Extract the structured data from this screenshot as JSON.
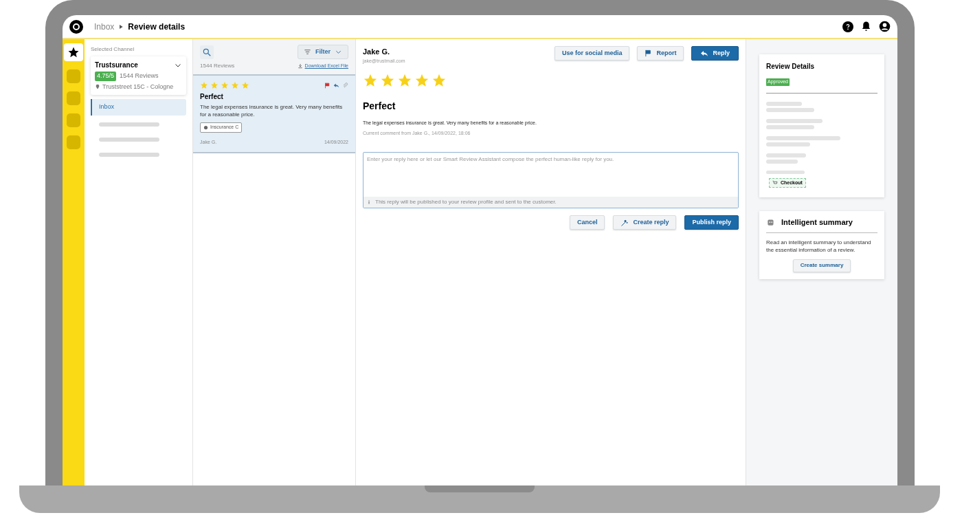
{
  "breadcrumb": [
    "Inbox",
    "Review details"
  ],
  "channel": {
    "label": "Selected Channel",
    "name": "Trustsurance",
    "rating": "4.75/5",
    "reviews": "1544 Reviews",
    "address": "Truststreet 15C - Cologne"
  },
  "nav": [
    {
      "label": "Inbox",
      "selected": true
    }
  ],
  "list": {
    "filter": "Filter",
    "count": "1544 Reviews",
    "download": "Download Excel File",
    "reviews": [
      {
        "stars": 5,
        "title": "Perfect",
        "text": "The legal expenses insurance is great. Very many benefits for a reasonable price.",
        "tag": "Inscurance C",
        "author": "Jake G.",
        "date": "14/09/2022",
        "selected": true
      }
    ]
  },
  "detail": {
    "name": "Jake G.",
    "email": "jake@trustmail.com",
    "buttons": [
      {
        "kind": "plain",
        "label": "Use for social media"
      },
      {
        "kind": "flag",
        "label": "Report"
      },
      {
        "kind": "primary",
        "label": "Reply"
      }
    ],
    "stars": 5,
    "title": "Perfect",
    "text": "The legal expenses insurance is great. Very many benefits for a reasonable price.",
    "meta": "Current comment from Jake G., 14/09/2022, 18:06",
    "reply_placeholder": "Enter your reply here or let our Smart Review Assistant compose the perfect human-like reply for you.",
    "reply_note": "This reply will be published to your review profile and sent to the customer.",
    "actions": [
      {
        "kind": "plain",
        "label": "Cancel"
      },
      {
        "kind": "wand",
        "label": "Create reply"
      },
      {
        "kind": "primary",
        "label": "Publish reply"
      }
    ]
  },
  "review_details": {
    "title": "Review Details",
    "status": "Approved",
    "checkout": "Checkout"
  },
  "summary": {
    "title": "Intelligent summary",
    "text": "Read an intelligent summary to understand the essential information of a review.",
    "button": "Create summary"
  }
}
